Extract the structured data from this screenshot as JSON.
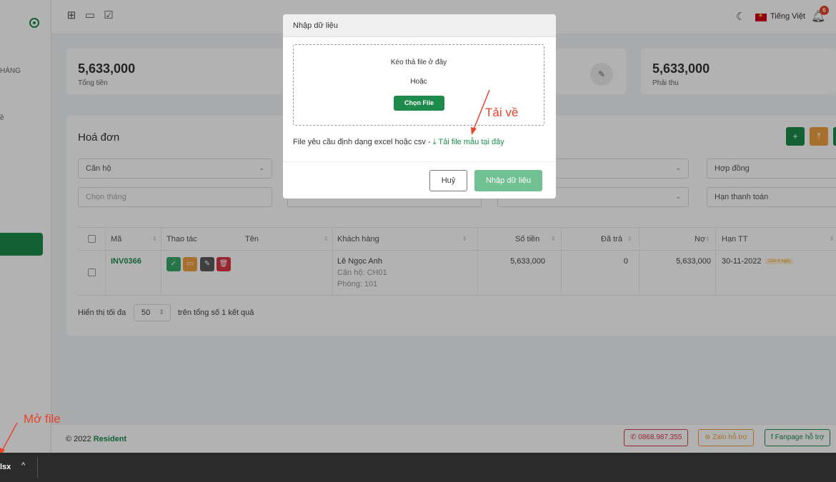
{
  "sidebar": {
    "nav_item_1": "HÀNG",
    "nav_item_2": "ề"
  },
  "topbar": {
    "language": "Tiếng Việt",
    "notification_count": "6"
  },
  "stats": [
    {
      "value": "5,633,000",
      "label": "Tổng tiền"
    },
    {
      "value": "5,633,000",
      "label": "Phải thu"
    }
  ],
  "invoices": {
    "title": "Hoá đơn",
    "filters": {
      "apartment": "Căn hộ",
      "contract": "Hợp đồng",
      "month_placeholder": "Chọn tháng",
      "due_date": "Hạn thanh toán"
    },
    "columns": {
      "code": "Mã",
      "actions": "Thao tác",
      "name": "Tên",
      "customer": "Khách hàng",
      "amount": "Số tiền",
      "paid": "Đã trả",
      "debt": "Nợ",
      "due": "Hạn TT"
    },
    "rows": [
      {
        "code": "INV0366",
        "name": "",
        "customer": "Lê Ngọc Anh",
        "apartment": "Căn hộ: CH01",
        "room": "Phòng: 101",
        "amount": "5,633,000",
        "paid": "0",
        "debt": "5,633,000",
        "due": "30-11-2022",
        "due_badge": "Còn 4 ngày"
      }
    ],
    "pager": {
      "prefix": "Hiển thị tối đa",
      "page_size": "50",
      "suffix": "trên tổng số 1 kết quả"
    }
  },
  "footer": {
    "copyright": "© 2022",
    "brand": "Resident",
    "phone": "0868.987.355",
    "zalo": "Zalo hỗ trợ",
    "fanpage": "Fanpage hỗ trợ"
  },
  "modal": {
    "title": "Nhập dữ liệu",
    "drop_text": "Kéo thả file ở đây",
    "or_text": "Hoặc",
    "choose_button": "Chọn File",
    "note": "File yêu cầu định dạng excel hoặc csv - ",
    "download_link": "Tải file mẫu tại đây",
    "cancel_button": "Huỷ",
    "import_button": "Nhập dữ liệu"
  },
  "annotations": {
    "download": "Tải về",
    "open_file": "Mở file"
  },
  "download_bar": {
    "file_name": "lsx"
  },
  "colors": {
    "brand_green": "#1e8a4c",
    "annotation_red": "#e8432b"
  }
}
